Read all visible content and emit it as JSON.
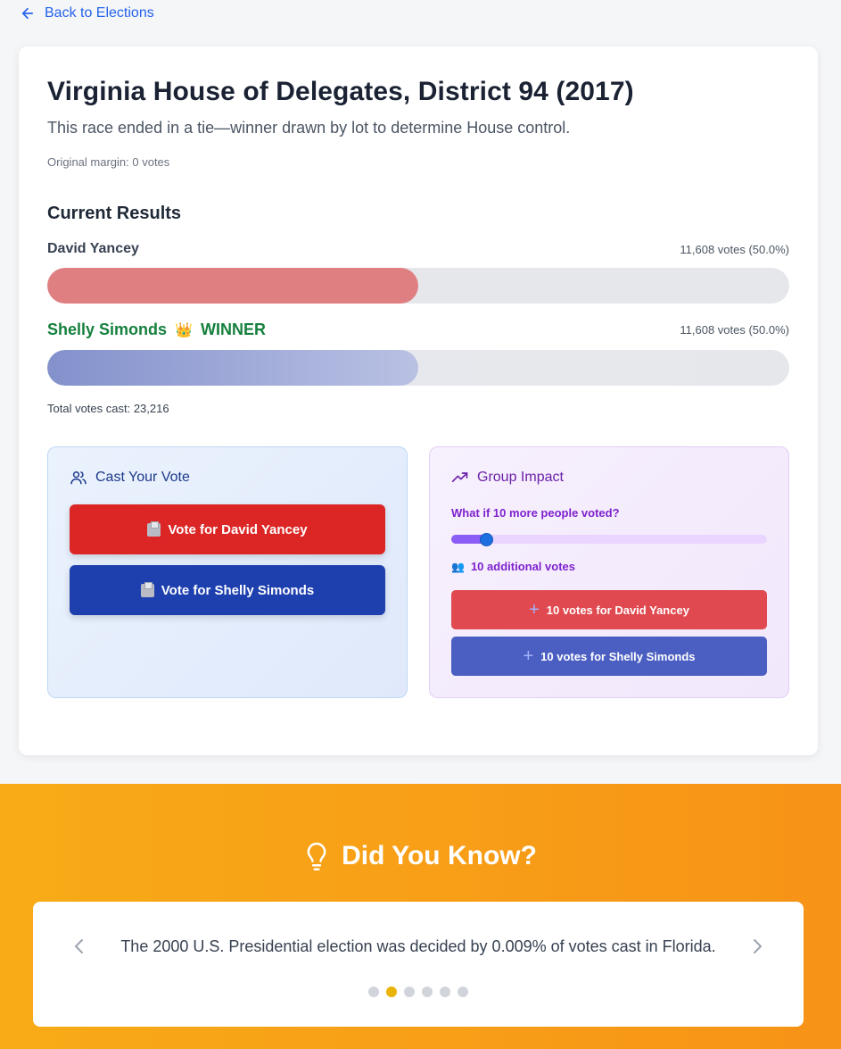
{
  "nav": {
    "back_label": "Back to Elections"
  },
  "election": {
    "title": "Virginia House of Delegates, District 94 (2017)",
    "subtitle": "This race ended in a tie—winner drawn by lot to determine House control.",
    "margin_note": "Original margin: 0 votes"
  },
  "results": {
    "heading": "Current Results",
    "candidates": [
      {
        "name": "David Yancey",
        "votes_text": "11,608 votes (50.0%)",
        "share": 0.5,
        "color": "#e07f82"
      },
      {
        "name": "Shelly Simonds",
        "crown": "👑",
        "winner_label": "WINNER",
        "votes_text": "11,608 votes (50.0%)",
        "share": 0.5,
        "color": "#8391cc"
      }
    ],
    "total": "Total votes cast: 23,216"
  },
  "cast": {
    "heading": "Cast Your Vote",
    "btn_yancey": "Vote for David Yancey",
    "btn_simonds": "Vote for Shelly Simonds"
  },
  "group": {
    "heading": "Group Impact",
    "question": "What if 10 more people voted?",
    "slider_fraction": 0.08,
    "additional": "10 additional votes",
    "btn_yancey": "10 votes for David Yancey",
    "btn_simonds": "10 votes for Shelly Simonds"
  },
  "dyk": {
    "title": "Did You Know?",
    "fact": "The 2000 U.S. Presidential election was decided by 0.009% of votes cast in Florida.",
    "dots_count": 6,
    "active_index": 1
  },
  "colors": {
    "accent_blue": "#2563eb",
    "vote_red": "#dc2626",
    "vote_blue": "#1e40af",
    "winner_green": "#15803d",
    "dyk_orange": "#f79317"
  }
}
